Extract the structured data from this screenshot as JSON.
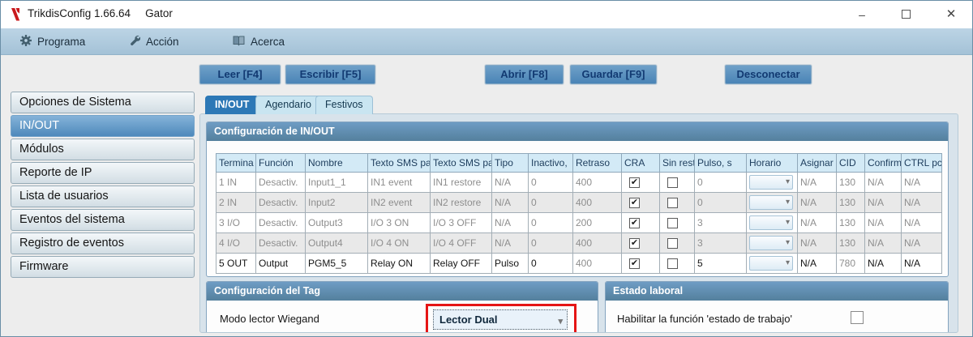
{
  "window": {
    "title": "TrikdisConfig 1.66.64",
    "device": "Gator"
  },
  "titlebar": {
    "minimize_icon": "–",
    "maximize_icon": "□",
    "close_icon": "✕"
  },
  "menu": {
    "programa": {
      "label": "Programa",
      "icon": "gear-icon"
    },
    "accion": {
      "label": "Acción",
      "icon": "wrench-icon"
    },
    "acerca": {
      "label": "Acerca",
      "icon": "book-icon"
    }
  },
  "toolbar": {
    "read": "Leer [F4]",
    "write": "Escribir [F5]",
    "open": "Abrir [F8]",
    "save": "Guardar [F9]",
    "disconnect": "Desconectar"
  },
  "sidebar": {
    "items": [
      "Opciones de Sistema",
      "IN/OUT",
      "Módulos",
      "Reporte de IP",
      "Lista de usuarios",
      "Eventos del sistema",
      "Registro de eventos",
      "Firmware"
    ],
    "selected": "IN/OUT"
  },
  "tabs": {
    "items": [
      "IN/OUT",
      "Agendario",
      "Festivos"
    ],
    "active": "IN/OUT"
  },
  "inout_section": {
    "title": "Configuración de IN/OUT",
    "columns": [
      "Termina",
      "Función",
      "Nombre",
      "Texto SMS pa",
      "Texto SMS pa",
      "Tipo",
      "Inactivo,",
      "Retraso",
      "CRA",
      "Sin rest",
      "Pulso, s",
      "Horario",
      "Asignar",
      "CID",
      "Confirm",
      "CTRL pc"
    ],
    "rows": [
      {
        "terminal": "1 IN",
        "funcion": "Desactiv.",
        "nombre": "Input1_1",
        "texto_sms_event": "IN1 event",
        "texto_sms_restore": "IN1 restore",
        "tipo": "N/A",
        "inactivo": "0",
        "retraso": "400",
        "cra": true,
        "sin_rest": false,
        "pulso": "0",
        "horario": "",
        "asignar": "N/A",
        "cid": "130",
        "confirm": "N/A",
        "ctrl": "N/A",
        "enabled": false
      },
      {
        "terminal": "2 IN",
        "funcion": "Desactiv.",
        "nombre": "Input2",
        "texto_sms_event": "IN2 event",
        "texto_sms_restore": "IN2 restore",
        "tipo": "N/A",
        "inactivo": "0",
        "retraso": "400",
        "cra": true,
        "sin_rest": false,
        "pulso": "0",
        "horario": "",
        "asignar": "N/A",
        "cid": "130",
        "confirm": "N/A",
        "ctrl": "N/A",
        "enabled": false
      },
      {
        "terminal": "3 I/O",
        "funcion": "Desactiv.",
        "nombre": "Output3",
        "texto_sms_event": "I/O 3 ON",
        "texto_sms_restore": "I/O 3 OFF",
        "tipo": "N/A",
        "inactivo": "0",
        "retraso": "200",
        "cra": true,
        "sin_rest": false,
        "pulso": "3",
        "horario": "",
        "asignar": "N/A",
        "cid": "130",
        "confirm": "N/A",
        "ctrl": "N/A",
        "enabled": false
      },
      {
        "terminal": "4 I/O",
        "funcion": "Desactiv.",
        "nombre": "Output4",
        "texto_sms_event": "I/O 4 ON",
        "texto_sms_restore": "I/O 4 OFF",
        "tipo": "N/A",
        "inactivo": "0",
        "retraso": "400",
        "cra": true,
        "sin_rest": false,
        "pulso": "3",
        "horario": "",
        "asignar": "N/A",
        "cid": "130",
        "confirm": "N/A",
        "ctrl": "N/A",
        "enabled": false
      },
      {
        "terminal": "5 OUT",
        "funcion": "Output",
        "nombre": "PGM5_5",
        "texto_sms_event": "Relay ON",
        "texto_sms_restore": "Relay OFF",
        "tipo": "Pulso",
        "inactivo": "0",
        "retraso": "400",
        "cra": true,
        "sin_rest": false,
        "pulso": "5",
        "horario": "",
        "asignar": "N/A",
        "cid": "780",
        "confirm": "N/A",
        "ctrl": "N/A",
        "enabled": true
      }
    ]
  },
  "tag_section": {
    "title": "Configuración del Tag",
    "mode_label": "Modo lector Wiegand",
    "mode_value": "Lector Dual"
  },
  "estado_section": {
    "title": "Estado laboral",
    "enable_label": "Habilitar la función 'estado de trabajo'",
    "checked": false
  },
  "colors": {
    "accent_blue": "#2d78b6",
    "group_header_blue": "#5e8fb8",
    "menu_blue": "#aecbdf",
    "button_blue": "#4a84b6",
    "annotation_red": "#e51515",
    "logo_red": "#c9191c"
  }
}
